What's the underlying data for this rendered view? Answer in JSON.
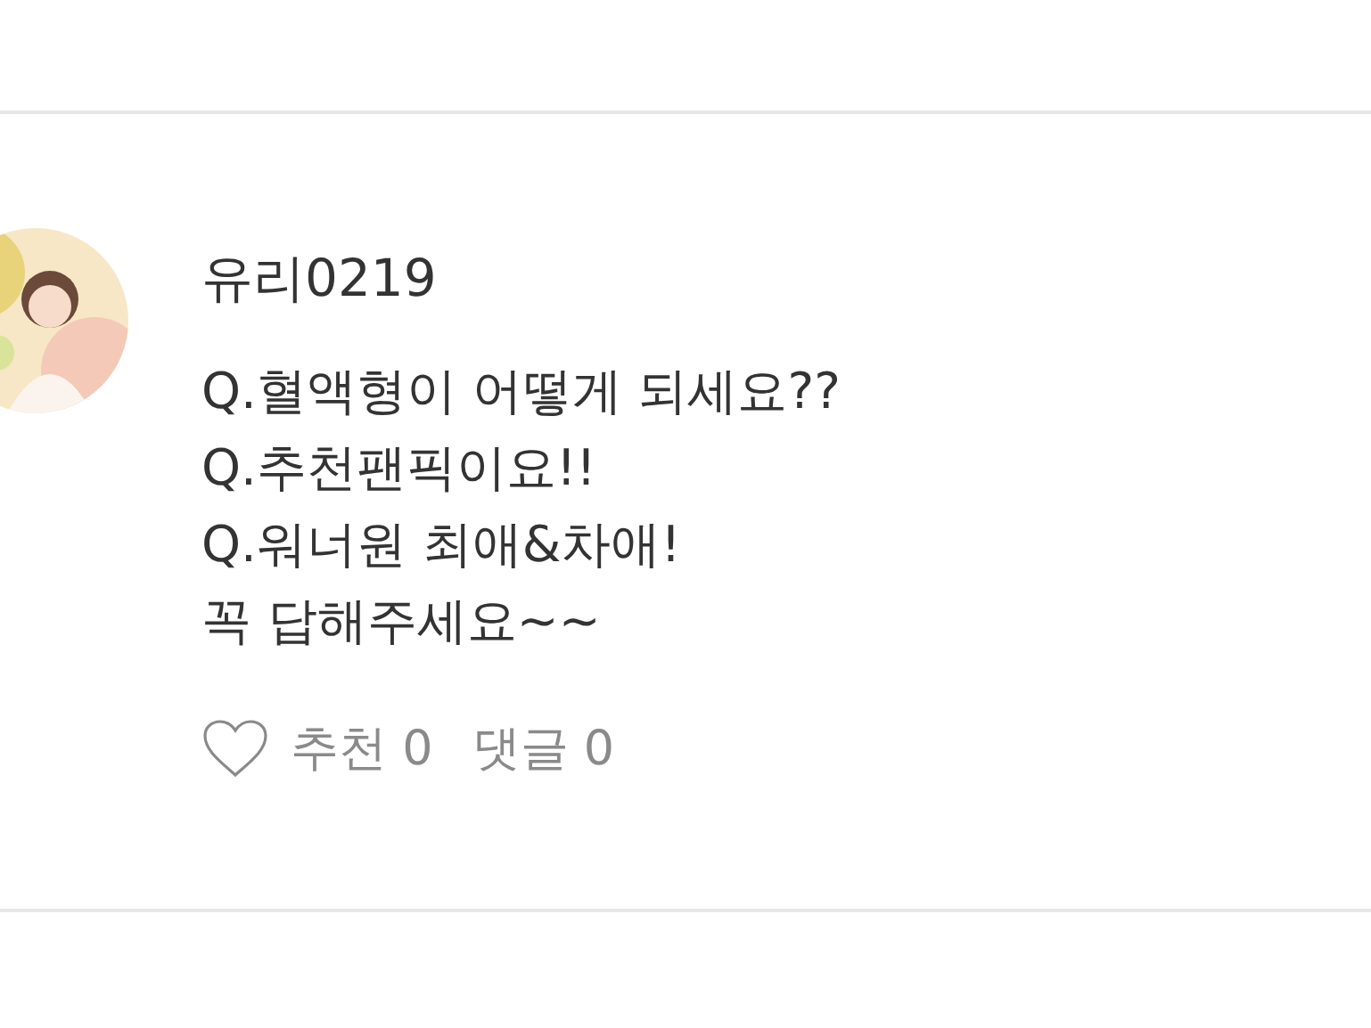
{
  "comment": {
    "author": "유리0219",
    "lines": [
      "Q.혈액형이 어떻게 되세요??",
      "Q.추천팬픽이요!!",
      "Q.워너원 최애&차애!",
      "꼭 답해주세요~~"
    ],
    "liked": false,
    "likes": "추천 0",
    "replies": "댓글 0"
  }
}
